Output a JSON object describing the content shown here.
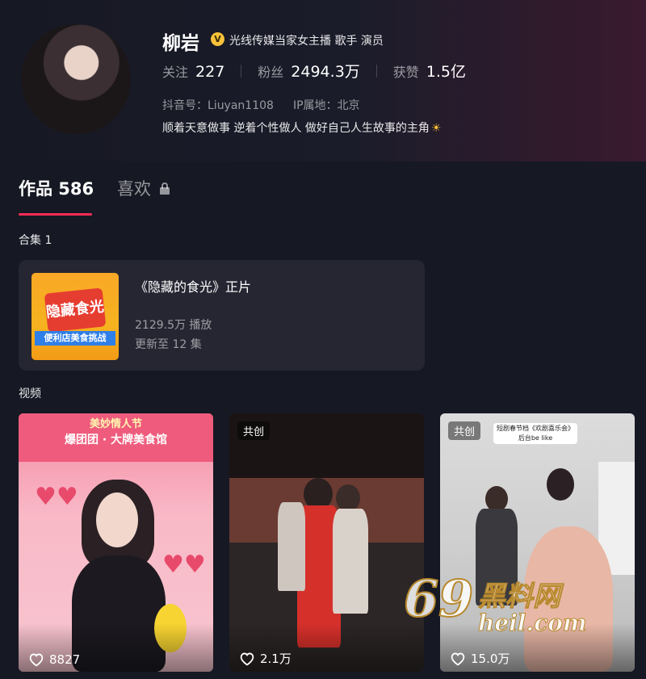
{
  "profile": {
    "name": "柳岩",
    "verify_badge": "V",
    "verify_text": "光线传媒当家女主播 歌手 演员",
    "stats": {
      "following_label": "关注",
      "following_value": "227",
      "followers_label": "粉丝",
      "followers_value": "2494.3万",
      "likes_label": "获赞",
      "likes_value": "1.5亿"
    },
    "douyin_id": "抖音号：Liuyan1108",
    "ip_location": "IP属地：北京",
    "bio": "顺着天意做事 逆着个性做人 做好自己人生故事的主角",
    "bio_emoji": "☀"
  },
  "tabs": {
    "works": "作品 586",
    "likes": "喜欢"
  },
  "collections": {
    "label": "合集 1",
    "card": {
      "cover_title": "隐藏食光",
      "cover_banner": "便利店美食挑战",
      "title": "《隐藏的食光》正片",
      "plays": "2129.5万 播放",
      "updated": "更新至 12 集"
    }
  },
  "videos": {
    "label": "视频",
    "items": [
      {
        "tag": "",
        "head1": "美妙情人节",
        "head2": "爆团团 · 大牌美食馆",
        "likes": "8827"
      },
      {
        "tag": "共创",
        "likes": "2.1万"
      },
      {
        "tag": "共创",
        "caption": "短剧春节档《欢剧喜乐会》 后台be like",
        "likes": "15.0万"
      }
    ]
  },
  "watermark": {
    "big": "69",
    "cn": "黑料网",
    "url": "heil.com"
  },
  "colors": {
    "background": "#161823",
    "accent": "#fe2c55",
    "card": "#252632",
    "verify": "#f8c23a"
  }
}
